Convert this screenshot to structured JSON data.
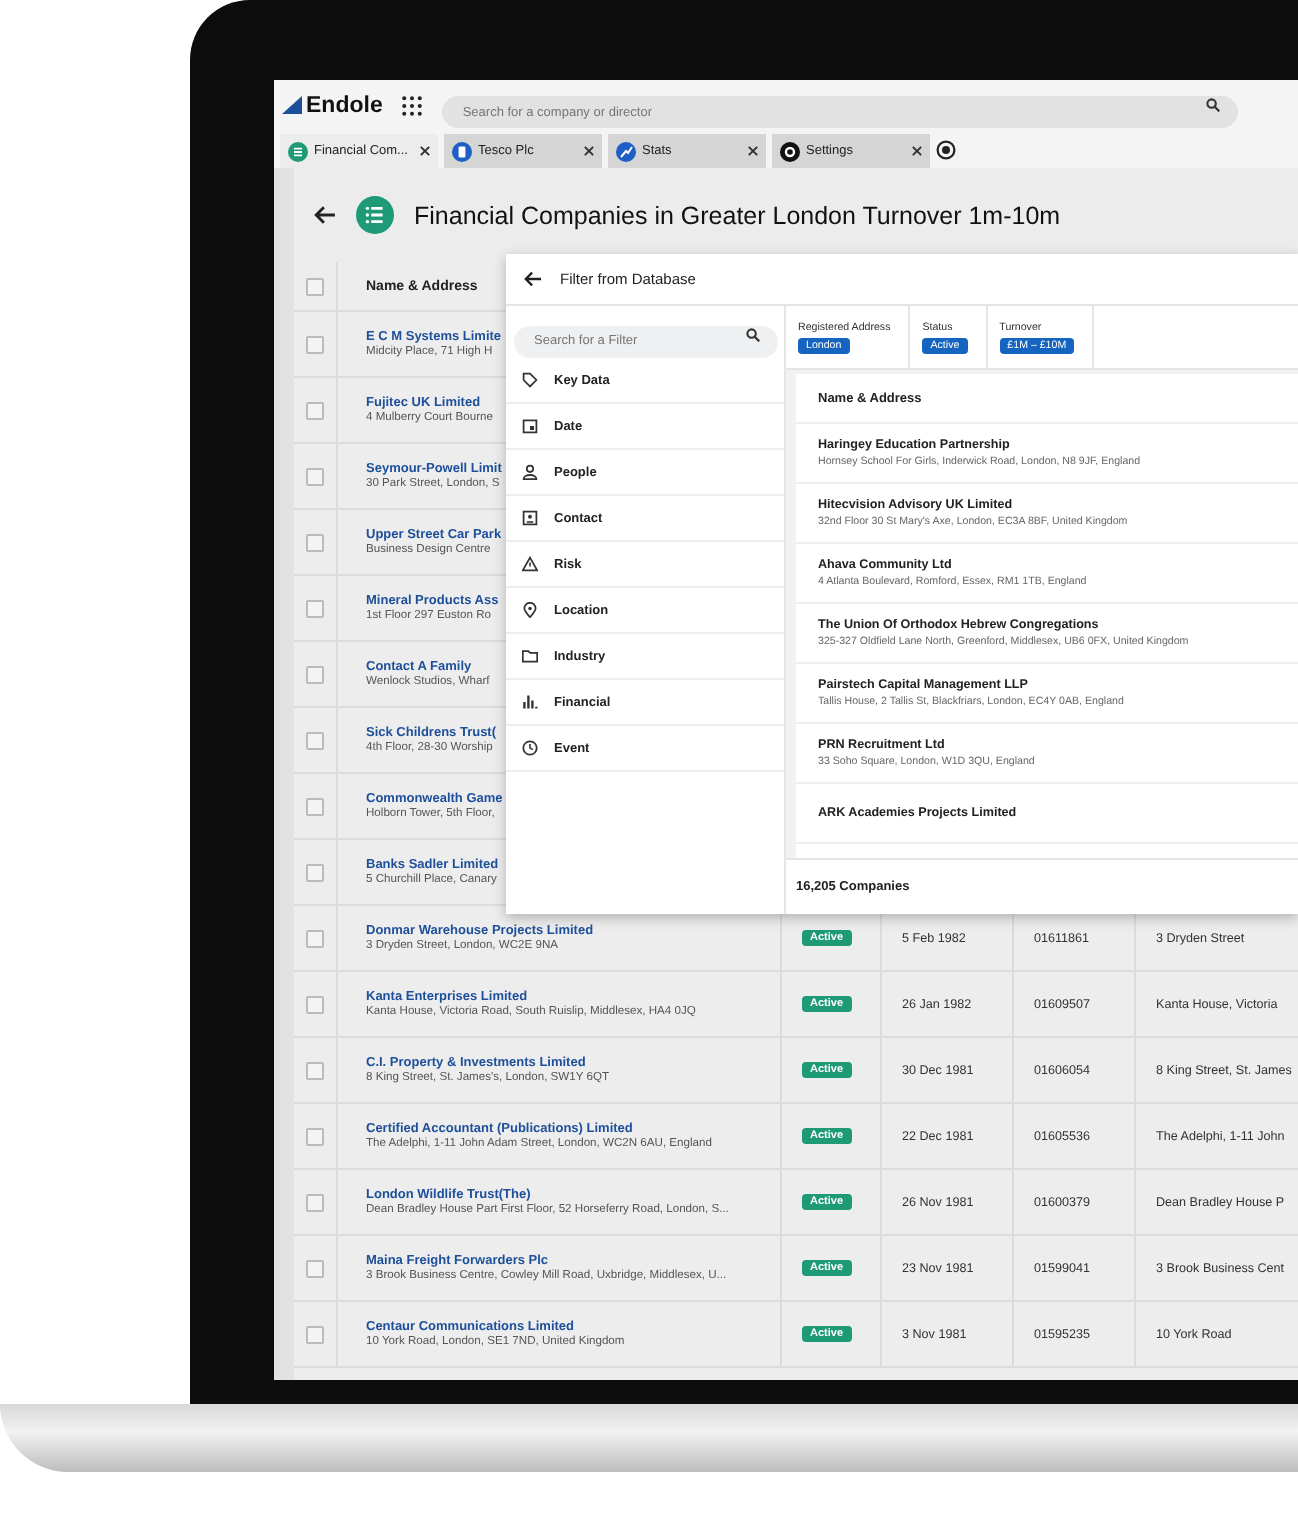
{
  "app": {
    "logo": "Endole",
    "search": {
      "placeholder": "Search for a company or director"
    }
  },
  "tabs": [
    {
      "label": "Financial Com...",
      "selected": true,
      "kind": "list"
    },
    {
      "label": "Tesco Plc",
      "selected": false,
      "kind": "doc"
    },
    {
      "label": "Stats",
      "selected": false,
      "kind": "chart"
    },
    {
      "label": "Settings",
      "selected": false,
      "kind": "gear"
    }
  ],
  "page": {
    "title": "Financial Companies in Greater London Turnover 1m-10m"
  },
  "table": {
    "header": {
      "label": "Name & Address",
      "checked": false
    },
    "rows": [
      {
        "checked": false,
        "name": "E C M Systems Limite",
        "address": "Midcity Place, 71 High H"
      },
      {
        "checked": false,
        "name": "Fujitec UK Limited",
        "address": "4 Mulberry Court Bourne"
      },
      {
        "checked": false,
        "name": "Seymour-Powell Limit",
        "address": "30 Park Street, London, S"
      },
      {
        "checked": false,
        "name": "Upper Street Car Park",
        "address": "Business Design Centre"
      },
      {
        "checked": false,
        "name": "Mineral Products Ass",
        "address": "1st Floor 297 Euston Ro"
      },
      {
        "checked": false,
        "name": "Contact A Family",
        "address": "Wenlock Studios, Wharf"
      },
      {
        "checked": false,
        "name": "Sick Childrens Trust(",
        "address": "4th Floor, 28-30 Worship"
      },
      {
        "checked": false,
        "name": "Commonwealth Game",
        "address": "Holborn Tower, 5th Floor,"
      },
      {
        "checked": false,
        "name": "Banks Sadler Limited",
        "address": "5 Churchill Place, Canary"
      },
      {
        "checked": false,
        "name": "Donmar Warehouse Projects Limited",
        "address": "3 Dryden Street, London, WC2E 9NA",
        "status": "Active",
        "date": "5 Feb 1982",
        "number": "01611861",
        "street": "3 Dryden Street"
      },
      {
        "checked": false,
        "name": "Kanta Enterprises Limited",
        "address": "Kanta House, Victoria Road, South Ruislip, Middlesex, HA4 0JQ",
        "status": "Active",
        "date": "26 Jan 1982",
        "number": "01609507",
        "street": "Kanta House, Victoria"
      },
      {
        "checked": false,
        "name": "C.I. Property & Investments Limited",
        "address": "8 King Street, St. James's, London, SW1Y 6QT",
        "status": "Active",
        "date": "30 Dec 1981",
        "number": "01606054",
        "street": "8 King Street, St. James"
      },
      {
        "checked": false,
        "name": "Certified Accountant (Publications) Limited",
        "address": "The Adelphi, 1-11 John Adam Street, London, WC2N 6AU, England",
        "status": "Active",
        "date": "22 Dec 1981",
        "number": "01605536",
        "street": "The Adelphi, 1-11 John"
      },
      {
        "checked": false,
        "name": "London Wildlife Trust(The)",
        "address": "Dean Bradley House Part First Floor, 52 Horseferry Road, London, S...",
        "status": "Active",
        "date": "26 Nov 1981",
        "number": "01600379",
        "street": "Dean Bradley House P"
      },
      {
        "checked": false,
        "name": "Maina Freight Forwarders Plc",
        "address": "3 Brook Business Centre, Cowley Mill Road, Uxbridge, Middlesex, U...",
        "status": "Active",
        "date": "23 Nov 1981",
        "number": "01599041",
        "street": "3 Brook Business Cent"
      },
      {
        "checked": false,
        "name": "Centaur Communications Limited",
        "address": "10 York Road, London, SE1 7ND, United Kingdom",
        "status": "Active",
        "date": "3 Nov 1981",
        "number": "01595235",
        "street": "10 York Road"
      }
    ]
  },
  "filter_panel": {
    "title": "Filter from Database",
    "search": {
      "placeholder": "Search for a Filter"
    },
    "categories": [
      {
        "label": "Key Data",
        "kind": "tag"
      },
      {
        "label": "Date",
        "kind": "calendar"
      },
      {
        "label": "People",
        "kind": "person"
      },
      {
        "label": "Contact",
        "kind": "contact"
      },
      {
        "label": "Risk",
        "kind": "warning"
      },
      {
        "label": "Location",
        "kind": "pin"
      },
      {
        "label": "Industry",
        "kind": "folder"
      },
      {
        "label": "Financial",
        "kind": "bars"
      },
      {
        "label": "Event",
        "kind": "clock"
      }
    ],
    "active_filters": [
      {
        "label": "Registered Address",
        "value": "London"
      },
      {
        "label": "Status",
        "value": "Active"
      },
      {
        "label": "Turnover",
        "value": "£1M – £10M"
      }
    ],
    "results_header": "Name & Address",
    "results": [
      {
        "name": "Haringey Education Partnership",
        "address": "Hornsey School For Girls, Inderwick Road, London, N8 9JF, England"
      },
      {
        "name": "Hitecvision Advisory UK Limited",
        "address": "32nd Floor 30 St Mary's Axe, London, EC3A 8BF, United Kingdom"
      },
      {
        "name": "Ahava Community Ltd",
        "address": "4 Atlanta Boulevard, Romford, Essex, RM1 1TB, England"
      },
      {
        "name": "The Union Of Orthodox Hebrew Congregations",
        "address": "325-327 Oldfield Lane North, Greenford, Middlesex, UB6 0FX, United Kingdom"
      },
      {
        "name": "Pairstech Capital Management LLP",
        "address": "Tallis House, 2 Tallis St, Blackfriars, London, EC4Y 0AB, England"
      },
      {
        "name": "PRN Recruitment Ltd",
        "address": "33 Soho Square, London, W1D 3QU, England"
      },
      {
        "name": "ARK Academies Projects Limited"
      }
    ],
    "count": "16,205 Companies"
  }
}
